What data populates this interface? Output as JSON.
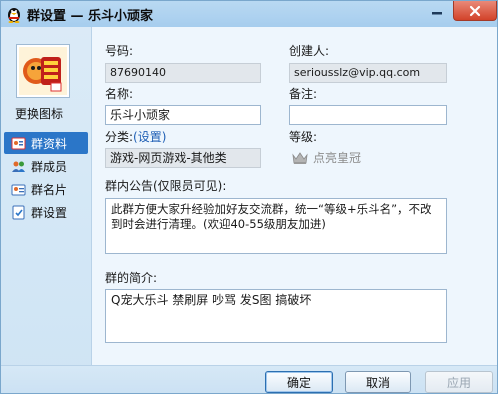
{
  "window": {
    "title": "群设置 — 乐斗小顽家"
  },
  "left": {
    "change_icon_label": "更换图标",
    "nav": [
      {
        "label": "群资料",
        "icon": "group-info-icon",
        "active": true
      },
      {
        "label": "群成员",
        "icon": "members-icon",
        "active": false
      },
      {
        "label": "群名片",
        "icon": "card-icon",
        "active": false
      },
      {
        "label": "群设置",
        "icon": "settings-icon",
        "active": false
      }
    ]
  },
  "form": {
    "number_label": "号码:",
    "number_value": "87690140",
    "creator_label": "创建人:",
    "creator_value": "seriousslz@vip.qq.com",
    "name_label": "名称:",
    "name_value": "乐斗小顽家",
    "remark_label": "备注:",
    "remark_value": "",
    "category_label": "分类:",
    "category_link": "(设置)",
    "category_value": "游戏-网页游戏-其他类",
    "level_label": "等级:",
    "level_value": "点亮皇冠",
    "notice_label": "群内公告(仅限员可见):",
    "notice_value": "此群方便大家升经验加好友交流群，统一“等级+乐斗名”，不改到时会进行清理。(欢迎40-55级朋友加进)",
    "intro_label": "群的简介:",
    "intro_value": "Q宠大乐斗  禁刷屏 吵骂 发S图  搞破坏"
  },
  "buttons": {
    "ok": "确定",
    "cancel": "取消",
    "apply": "应用"
  },
  "colors": {
    "nav_active": "#2b76c8",
    "link": "#1f5fb5",
    "close_button": "#d2422a"
  }
}
